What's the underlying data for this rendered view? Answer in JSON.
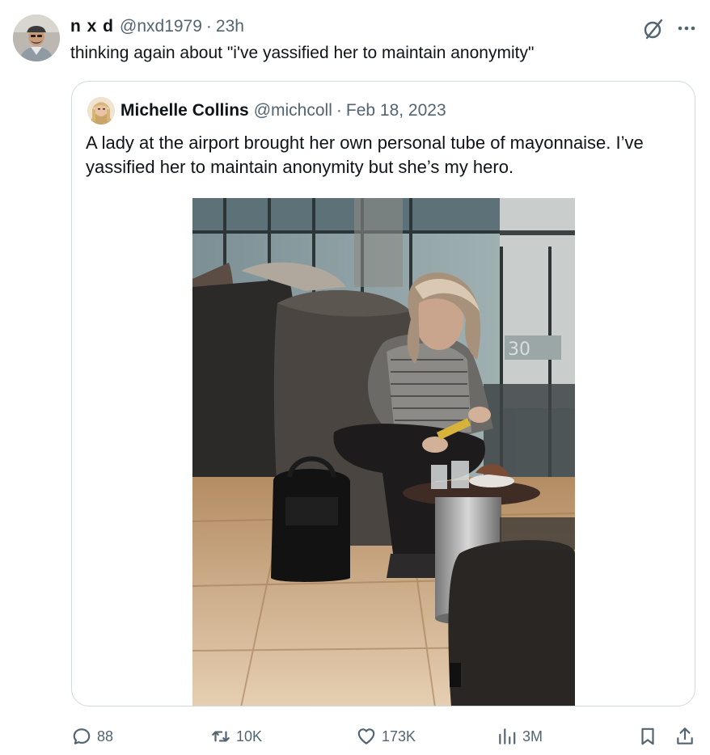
{
  "author": {
    "display_name": "n x d",
    "handle": "@nxd1979",
    "separator": "·",
    "time": "23h"
  },
  "tweet": {
    "text": "thinking again about \"i've yassified her to maintain anonymity\""
  },
  "quoted": {
    "display_name": "Michelle Collins",
    "handle": "@michcoll",
    "separator": "·",
    "date": "Feb 18, 2023",
    "text": "A lady at the airport brought her own personal tube of mayonnaise. I’ve yassified her to maintain anonymity but she’s my hero.",
    "media_sign_text": "30"
  },
  "actions": {
    "replies": "88",
    "reposts": "10K",
    "likes": "173K",
    "views": "3M"
  },
  "icons": {
    "grok": "grok-icon",
    "more": "more-icon",
    "reply": "reply-icon",
    "repost": "repost-icon",
    "like": "heart-icon",
    "views": "views-icon",
    "bookmark": "bookmark-icon",
    "share": "share-icon"
  },
  "colors": {
    "text": "#0f1419",
    "muted": "#536471",
    "border": "#cfd9de"
  }
}
